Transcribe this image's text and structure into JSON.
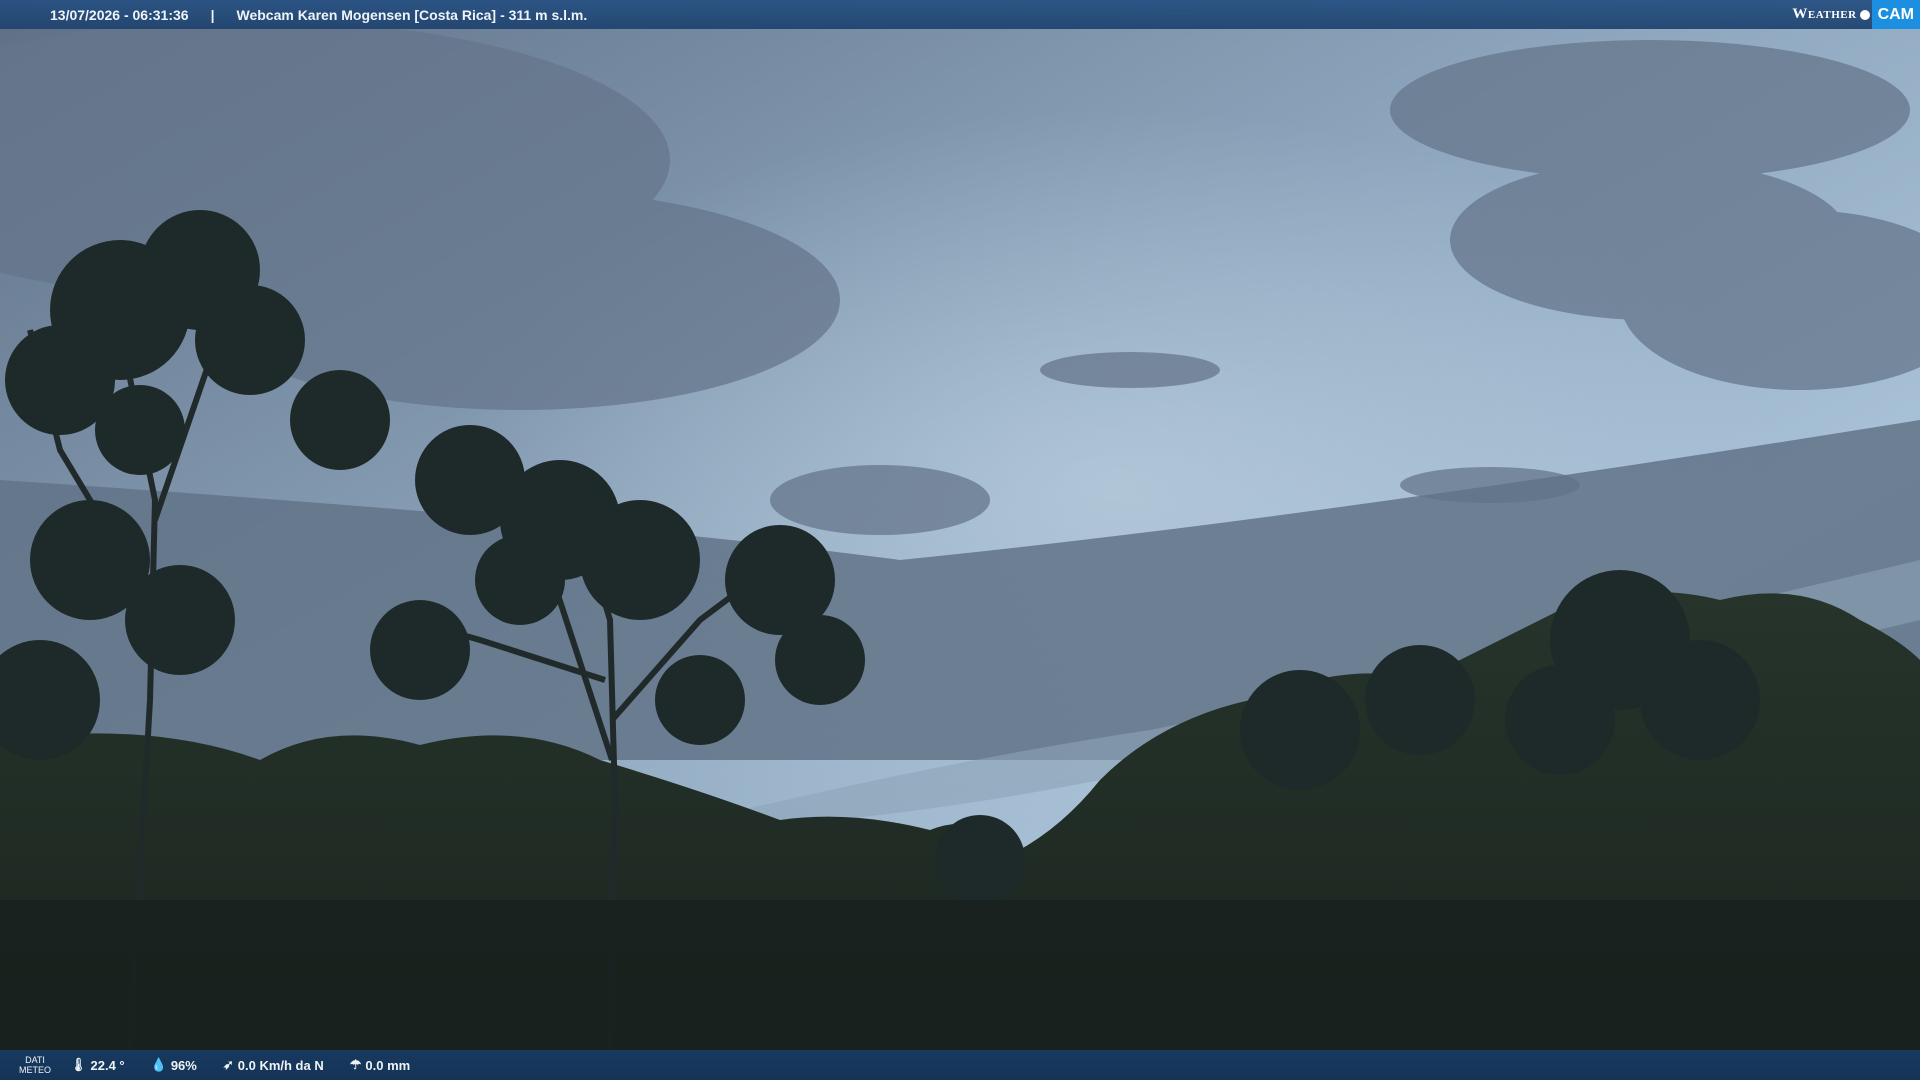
{
  "overlay": {
    "datetime": "13/07/2026 - 06:31:36",
    "separator": "|",
    "webcam_title": "Webcam Karen Mogensen [Costa Rica]",
    "altitude": "- 311 m s.l.m."
  },
  "logo": {
    "weather": "Weather",
    "cam": "CAM"
  },
  "meteo": {
    "label_line1": "DATI",
    "label_line2": "METEO",
    "temperature": "22.4 °",
    "humidity": "96%",
    "wind": "0.0 Km/h da N",
    "rain": "0.0 mm"
  },
  "icons": {
    "temperature": "thermometer-icon",
    "humidity": "humidity-drop-icon",
    "wind": "wind-icon",
    "rain": "rain-gauge-icon"
  },
  "colors": {
    "sky_top": "#6f88a3",
    "sky_mid": "#a6bfd3",
    "cloud": "#5d6e82",
    "forest": "#1f2b22",
    "bar": "#1f4a7d",
    "logo_accent": "#1c8fe0"
  }
}
